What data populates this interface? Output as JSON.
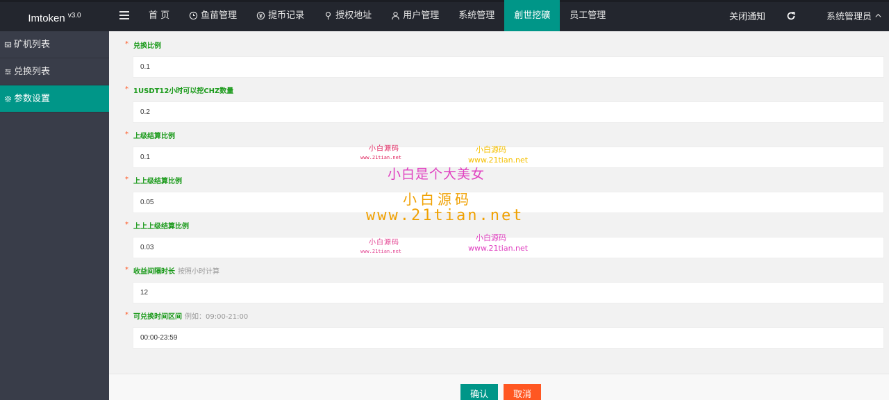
{
  "app": {
    "name": "Imtoken",
    "version": "v3.0"
  },
  "nav": {
    "items": [
      {
        "label": "首 页",
        "icon": ""
      },
      {
        "label": "鱼苗管理",
        "icon": "clock-icon"
      },
      {
        "label": "提币记录",
        "icon": "yen-icon"
      },
      {
        "label": "授权地址",
        "icon": "location-icon"
      },
      {
        "label": "用户管理",
        "icon": "user-icon"
      },
      {
        "label": "系统管理",
        "icon": ""
      },
      {
        "label": "創世挖礦",
        "icon": ""
      },
      {
        "label": "员工管理",
        "icon": ""
      }
    ],
    "active_index": 6
  },
  "top_right": {
    "notice": "关闭通知",
    "user": "系统管理员"
  },
  "sidebar": {
    "items": [
      {
        "label": "矿机列表",
        "icon": "card-icon"
      },
      {
        "label": "兑换列表",
        "icon": "sliders-icon"
      },
      {
        "label": "参数设置",
        "icon": "gear-icon"
      }
    ],
    "active_index": 2
  },
  "form": {
    "fields": [
      {
        "label": "兑换比例",
        "hint": "",
        "value": "0.1"
      },
      {
        "label": "1USDT12小时可以挖CHZ数量",
        "hint": "",
        "value": "0.2"
      },
      {
        "label": "上级结算比例",
        "hint": "",
        "value": "0.1"
      },
      {
        "label": "上上级结算比例",
        "hint": "",
        "value": "0.05"
      },
      {
        "label": "上上上级结算比例",
        "hint": "",
        "value": "0.03"
      },
      {
        "label": "收益间隔时长",
        "hint": "按照小时计算",
        "value": "12"
      },
      {
        "label": "可兑换时间区间",
        "hint": "例如：09:00-21:00",
        "value": "00:00-23:59"
      }
    ],
    "required_mark": "*"
  },
  "buttons": {
    "confirm": "确认",
    "cancel": "取消"
  },
  "watermarks": {
    "small_cn": "小白源码",
    "small_url_a": "www.21tian.net",
    "small_url_b": "www.21tian.net",
    "headline": "小白是个大美女",
    "big_cn": "小白源码",
    "big_url": "www.21tian.net",
    "colors": {
      "red": "#e0245e",
      "yellow": "#f5c000",
      "pink": "#e040c0",
      "magenta": "#e23e8e",
      "orange": "#f0a000"
    }
  },
  "colors": {
    "accent": "#009688",
    "danger": "#ff5722",
    "topbar": "#23262e",
    "sidebar": "#393d49",
    "label": "#1a9a1a"
  }
}
